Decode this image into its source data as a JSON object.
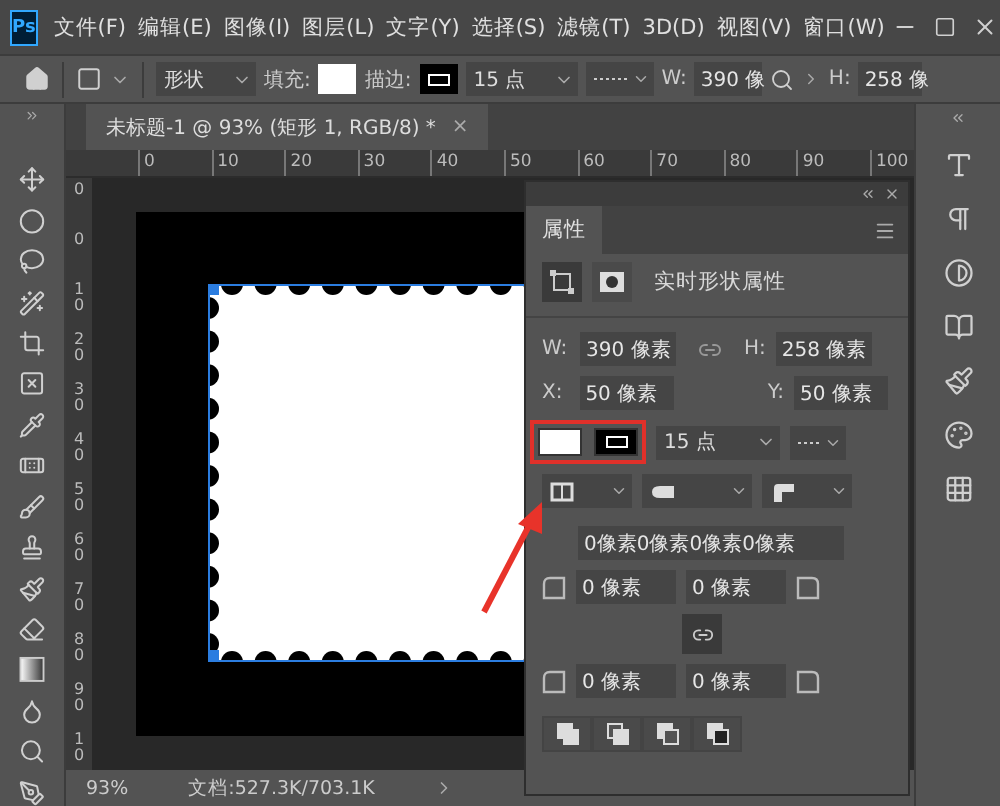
{
  "app_logo": "Ps",
  "menu": [
    "文件(F)",
    "编辑(E)",
    "图像(I)",
    "图层(L)",
    "文字(Y)",
    "选择(S)",
    "滤镜(T)",
    "3D(D)",
    "视图(V)",
    "窗口(W)"
  ],
  "options_bar": {
    "mode": "形状",
    "fill_label": "填充:",
    "stroke_label": "描边:",
    "stroke_width": "15 点",
    "w_label": "W:",
    "w_value": "390 像",
    "h_label": "H:",
    "h_value": "258 像"
  },
  "document_tab": {
    "title": "未标题-1 @ 93% (矩形 1, RGB/8) *",
    "close": "×"
  },
  "ruler": {
    "horizontal": [
      "0",
      "10",
      "20",
      "30",
      "40",
      "50",
      "60",
      "70",
      "80",
      "90",
      "100"
    ],
    "vertical": [
      "0",
      "0",
      "10",
      "20",
      "30",
      "40",
      "50",
      "60",
      "70",
      "80",
      "90",
      "10"
    ]
  },
  "properties_panel": {
    "tab": "属性",
    "section_title": "实时形状属性",
    "w_label": "W:",
    "w_value": "390 像素",
    "h_label": "H:",
    "h_value": "258 像素",
    "x_label": "X:",
    "x_value": "50 像素",
    "y_label": "Y:",
    "y_value": "50 像素",
    "stroke_width": "15 点",
    "corner_radii": "0像素0像素0像素0像素",
    "corners": [
      "0 像素",
      "0 像素",
      "0 像素",
      "0 像素"
    ]
  },
  "status_bar": {
    "zoom": "93%",
    "doc_info": "文档:527.3K/703.1K"
  }
}
